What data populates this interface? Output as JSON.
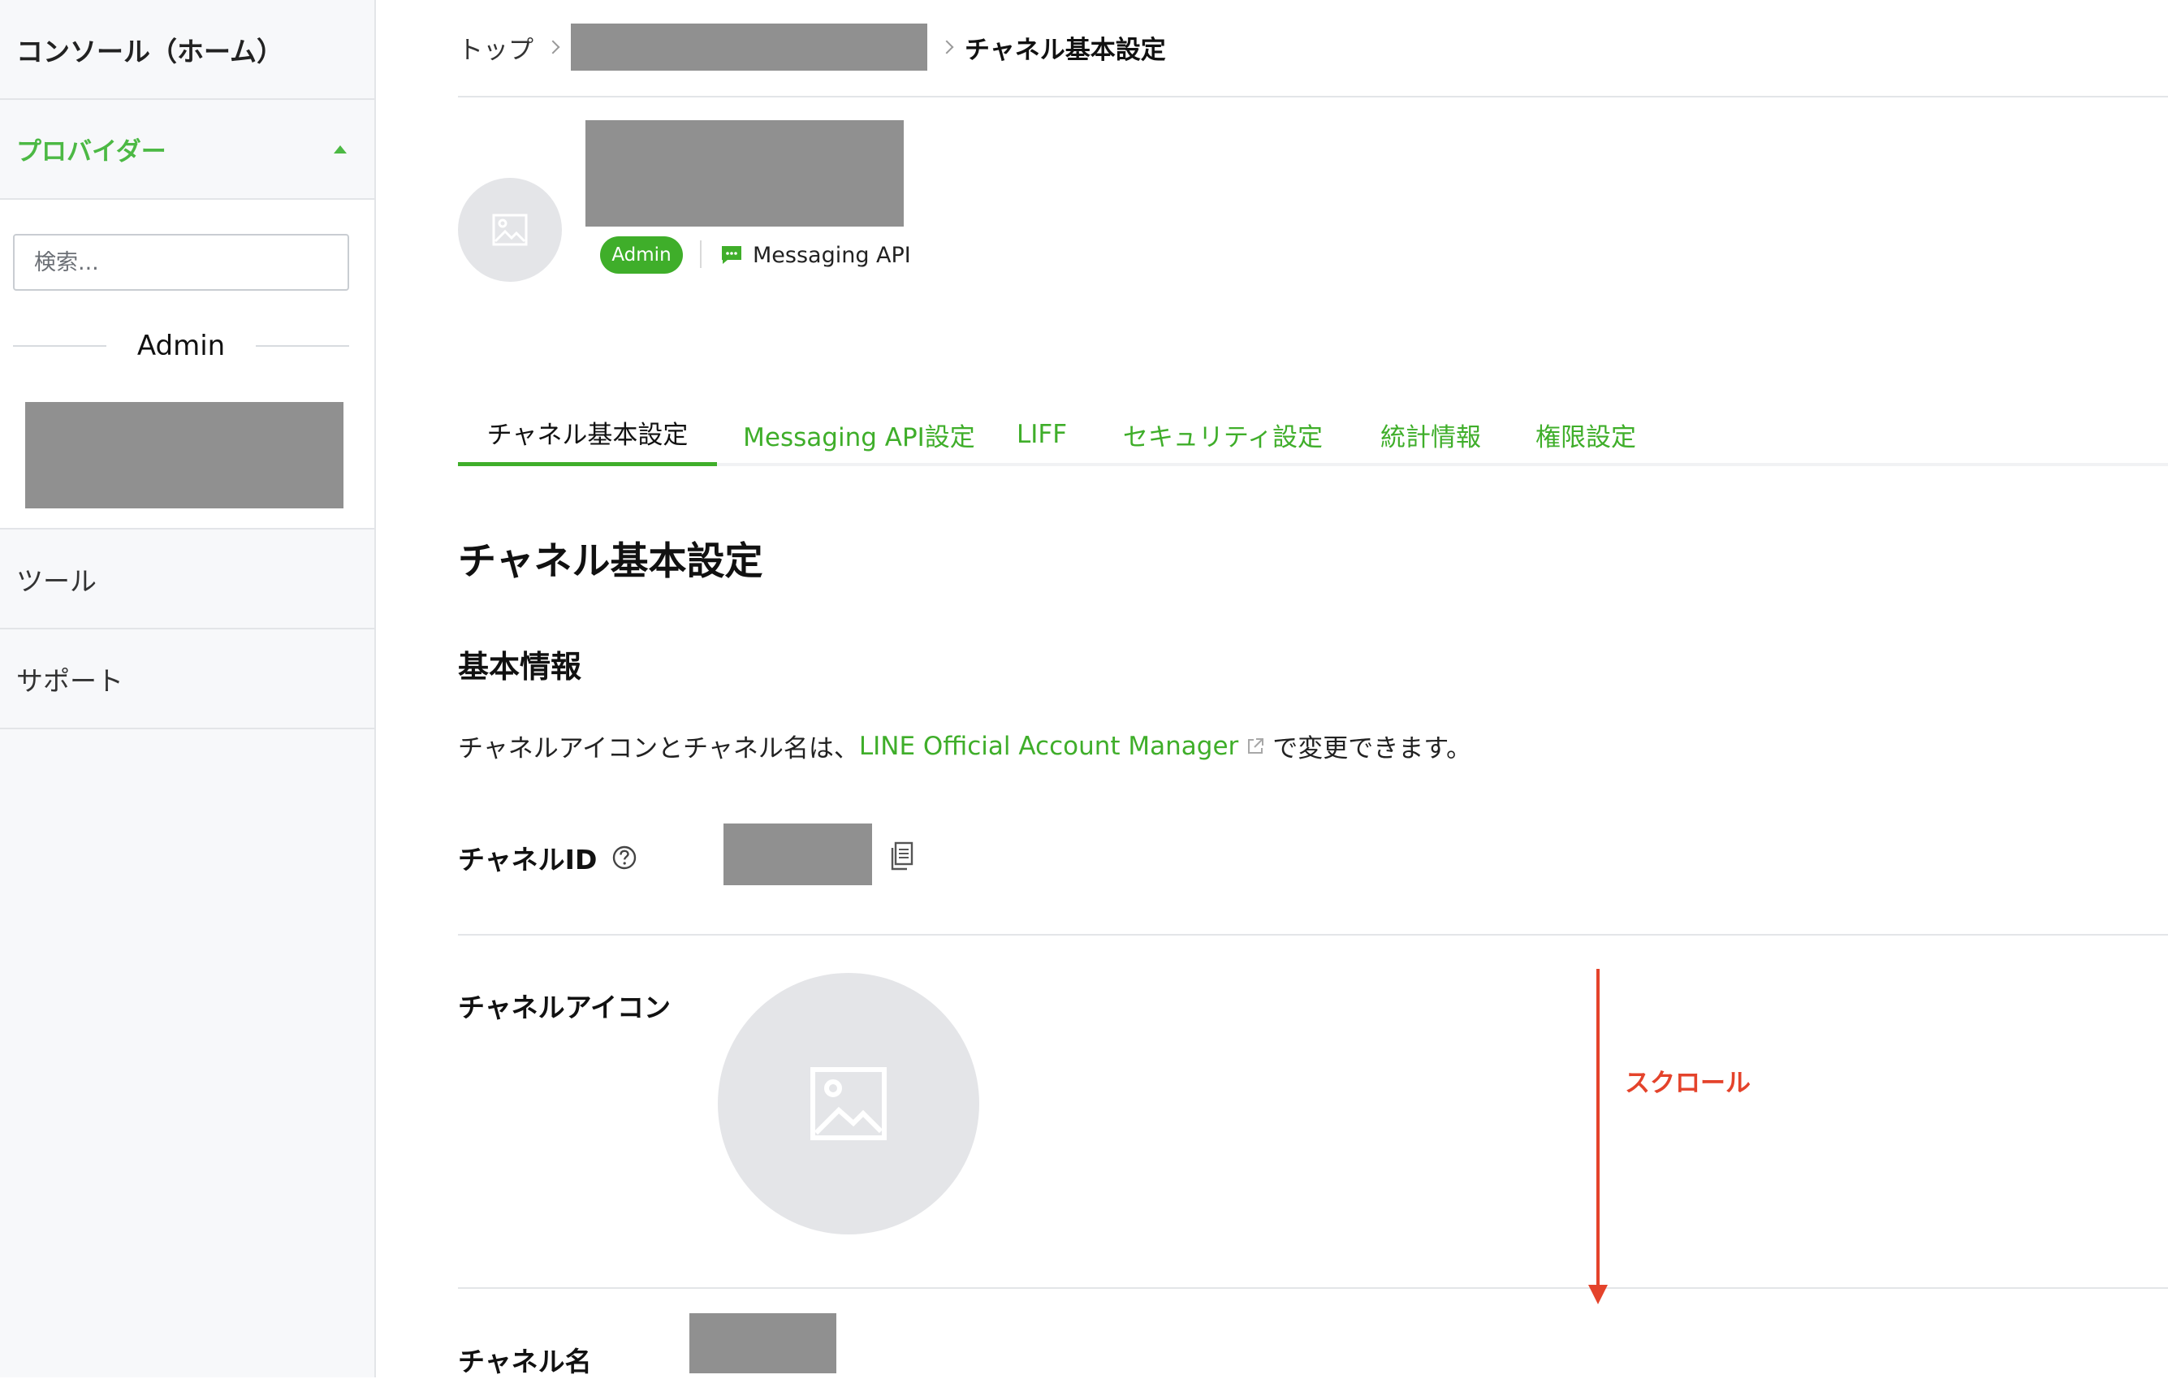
{
  "sidebar": {
    "console_label": "コンソール（ホーム）",
    "provider_label": "プロバイダー",
    "search_placeholder": "検索...",
    "admin_heading": "Admin",
    "tools_label": "ツール",
    "support_label": "サポート"
  },
  "breadcrumb": {
    "top": "トップ",
    "current": "チャネル基本設定"
  },
  "channel": {
    "role_badge": "Admin",
    "type_label": "Messaging API"
  },
  "tabs": [
    {
      "label": "チャネル基本設定",
      "active": true
    },
    {
      "label": "Messaging API設定",
      "active": false
    },
    {
      "label": "LIFF",
      "active": false
    },
    {
      "label": "セキュリティ設定",
      "active": false
    },
    {
      "label": "統計情報",
      "active": false
    },
    {
      "label": "権限設定",
      "active": false
    }
  ],
  "main": {
    "page_title": "チャネル基本設定",
    "section_title": "基本情報",
    "desc_prefix": "チャネルアイコンとチャネル名は、",
    "desc_link": "LINE Official Account Manager",
    "desc_suffix": "で変更できます。",
    "field_channel_id": "チャネルID",
    "field_channel_icon": "チャネルアイコン",
    "field_channel_name": "チャネル名"
  },
  "annotation": {
    "scroll_label": "スクロール"
  },
  "colors": {
    "accent_green": "#3fae2a",
    "annotation_red": "#e4432b",
    "redaction_gray": "#909090"
  }
}
